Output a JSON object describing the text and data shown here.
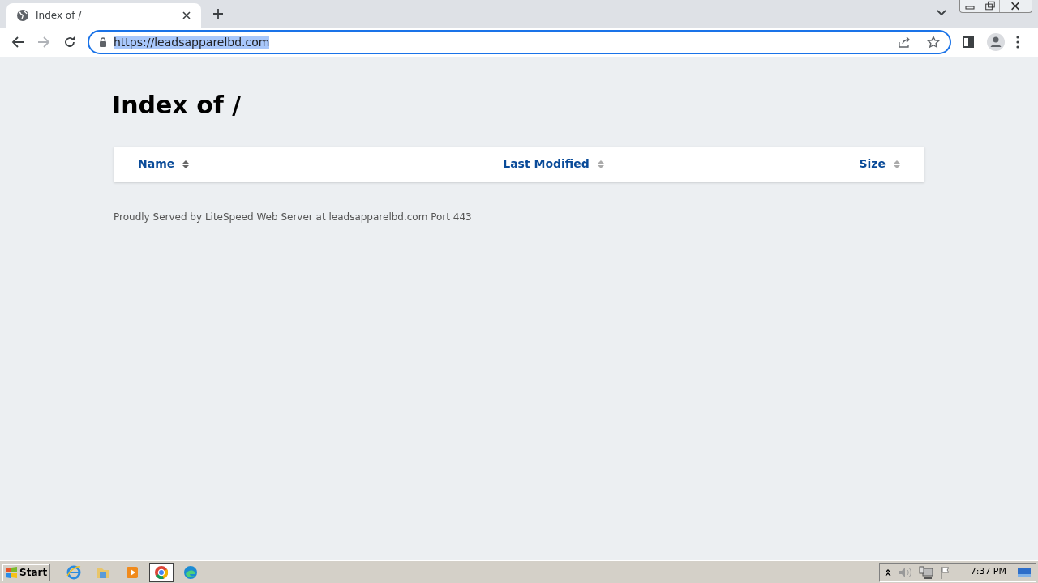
{
  "browser": {
    "tab": {
      "title": "Index of /"
    },
    "address": "https://leadsapparelbd.com",
    "address_selected": true
  },
  "page": {
    "heading": "Index of /",
    "columns": [
      {
        "label": "Name"
      },
      {
        "label": "Last Modified"
      },
      {
        "label": "Size"
      }
    ],
    "footer": "Proudly Served by LiteSpeed Web Server at leadsapparelbd.com Port 443"
  },
  "taskbar": {
    "start": "Start",
    "apps": [
      {
        "kind": "ie",
        "selected": false
      },
      {
        "kind": "folder",
        "selected": false
      },
      {
        "kind": "media",
        "selected": false
      },
      {
        "kind": "chrome",
        "selected": true
      },
      {
        "kind": "edge",
        "selected": false
      }
    ],
    "clock": "7:37 PM"
  }
}
